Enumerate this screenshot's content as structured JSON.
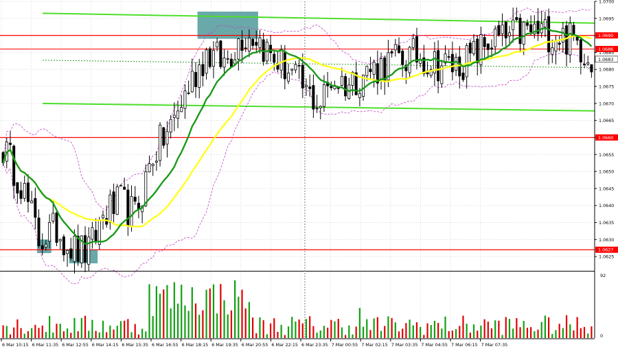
{
  "chart_data": {
    "type": "candlestick",
    "ylim": [
      1.0621,
      1.07
    ],
    "y_ticks": [
      "1.0625",
      "1.0630",
      "1.0635",
      "1.0640",
      "1.0645",
      "1.0650",
      "1.0655",
      "1.0660",
      "1.0665",
      "1.0670",
      "1.0675",
      "1.0680",
      "1.0685",
      "1.0690",
      "1.0695",
      "1.0700"
    ],
    "x_labels": [
      "6 Mar 10:15",
      "6 Mar 11:35",
      "6 Mar 12:55",
      "6 Mar 14:15",
      "6 Mar 15:35",
      "6 Mar 16:55",
      "6 Mar 18:15",
      "6 Mar 19:35",
      "6 Mar 20:55",
      "6 Mar 22:15",
      "6 Mar 23:35",
      "7 Mar 00:55",
      "7 Mar 02:15",
      "7 Mar 03:35",
      "7 Mar 04:55",
      "7 Mar 06:15",
      "7 Mar 07:35"
    ],
    "levels": [
      {
        "value": 1.069,
        "label": "1.0690",
        "color": "#ff0000"
      },
      {
        "value": 1.066,
        "label": "1.0660",
        "color": "#ff0000"
      },
      {
        "value": 1.0627,
        "label": "1.0627",
        "color": "#ff0000"
      },
      {
        "value": 1.0686,
        "label": "1.0686",
        "color": "#ff0000"
      }
    ],
    "current_price": {
      "value": 1.0683,
      "label": "1.0683"
    },
    "volume_max_label": "92",
    "volume_zero_label": "0",
    "channel_upper": {
      "from": 1.06965,
      "to": 1.06936
    },
    "channel_lower": {
      "from": 1.067,
      "to": 1.06678
    },
    "dotted_line": {
      "from": 1.06827,
      "to": 1.06805
    },
    "highlight_boxes": [
      {
        "from_bar": 55,
        "to_bar": 71,
        "low": 1.0689,
        "high": 1.0697
      },
      {
        "from_bar": 10,
        "to_bar": 13,
        "low": 1.0626,
        "high": 1.063
      },
      {
        "from_bar": 19,
        "to_bar": 26,
        "low": 1.0623,
        "high": 1.0627
      }
    ],
    "anchors": [
      [
        0,
        1.0657
      ],
      [
        5,
        1.0647
      ],
      [
        10,
        1.063
      ],
      [
        15,
        1.0633
      ],
      [
        20,
        1.0627
      ],
      [
        24,
        1.0626
      ],
      [
        28,
        1.0637
      ],
      [
        33,
        1.0641
      ],
      [
        37,
        1.0637
      ],
      [
        42,
        1.0655
      ],
      [
        47,
        1.0663
      ],
      [
        52,
        1.0675
      ],
      [
        57,
        1.0685
      ],
      [
        62,
        1.0682
      ],
      [
        67,
        1.069
      ],
      [
        71,
        1.069
      ],
      [
        75,
        1.0684
      ],
      [
        80,
        1.068
      ],
      [
        85,
        1.0673
      ],
      [
        89,
        1.067
      ],
      [
        92,
        1.0677
      ],
      [
        97,
        1.0676
      ],
      [
        101,
        1.0679
      ],
      [
        106,
        1.0681
      ],
      [
        111,
        1.0683
      ],
      [
        116,
        1.0684
      ],
      [
        121,
        1.0682
      ],
      [
        126,
        1.0681
      ],
      [
        131,
        1.0683
      ],
      [
        136,
        1.0688
      ],
      [
        141,
        1.0689
      ],
      [
        146,
        1.0691
      ],
      [
        151,
        1.0691
      ],
      [
        156,
        1.069
      ],
      [
        161,
        1.0688
      ],
      [
        165,
        1.0683
      ]
    ],
    "colors": {
      "up": "#1d7a1d",
      "down": "#000000",
      "ma_green": "#1a9a1a",
      "ma_yellow": "#ffff1e",
      "envelope": "#c040c0",
      "box": "#4f9a9a",
      "channel": "#4dde2a",
      "volume_up": "#10a010",
      "volume_down": "#e00000"
    }
  }
}
